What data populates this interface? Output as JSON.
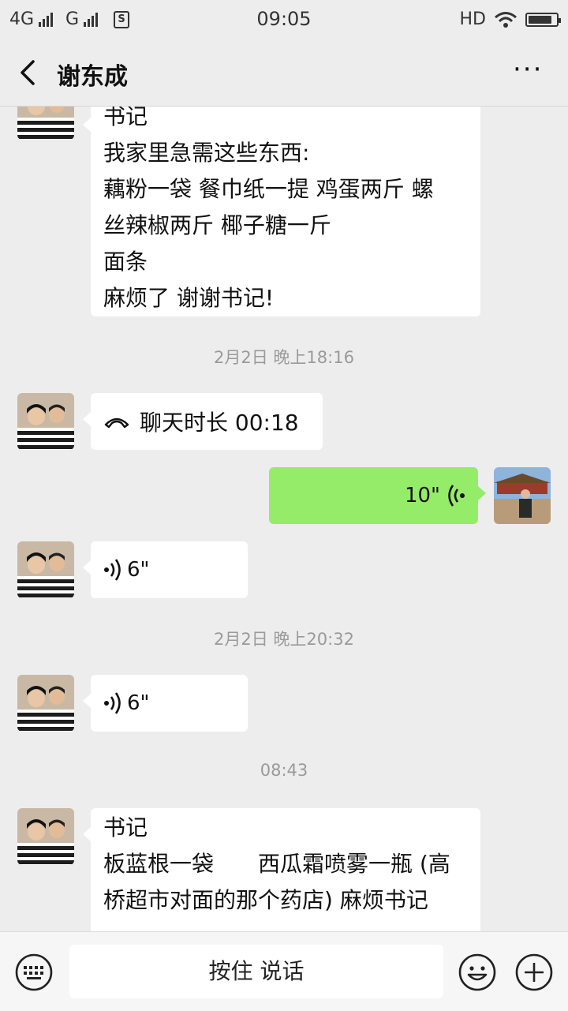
{
  "status_bar": {
    "net1": "4G",
    "net2": "G",
    "time": "09:05",
    "hd": "HD",
    "battery_level": 0.85
  },
  "header": {
    "title": "谢东成",
    "more": "···"
  },
  "messages": {
    "m1": {
      "lines": [
        "书记",
        "我家里急需这些东西:",
        "藕粉一袋 餐巾纸一提 鸡蛋两斤 螺",
        "丝辣椒两斤 椰子糖一斤",
        "面条",
        "麻烦了 谢谢书记!"
      ]
    },
    "ts1": "2月2日 晚上18:16",
    "m2": {
      "icon": "phone-hangup-icon",
      "text": "聊天时长 00:18"
    },
    "m3": {
      "icon": "voice-icon",
      "text": "10\""
    },
    "m4": {
      "icon": "voice-icon",
      "text": "6\""
    },
    "ts2": "2月2日 晚上20:32",
    "m5": {
      "icon": "voice-icon",
      "text": "6\""
    },
    "ts3": "08:43",
    "m6": {
      "lines": [
        "书记",
        "板蓝根一袋　　西瓜霜喷雾一瓶 (高",
        "桥超市对面的那个药店) 麻烦书记"
      ]
    }
  },
  "input_bar": {
    "talk_label": "按住 说话"
  },
  "colors": {
    "bg": "#ededed",
    "sent_bubble": "#95ec69",
    "received_bubble": "#ffffff",
    "timestamp": "#9a9a9a"
  }
}
